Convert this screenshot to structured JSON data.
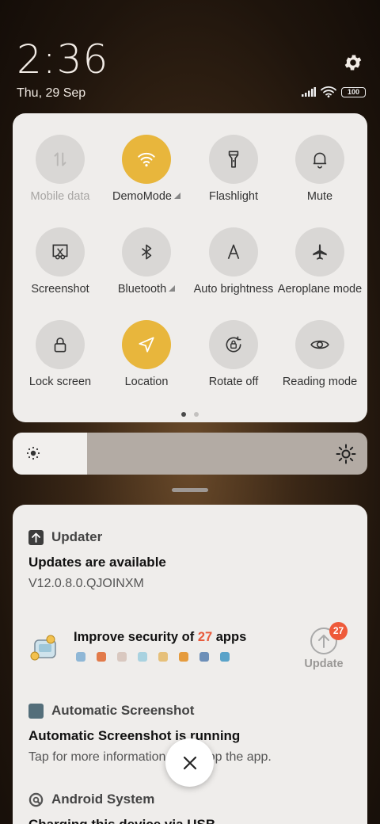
{
  "status": {
    "time": "2:36",
    "date": "Thu, 29 Sep",
    "battery": "100"
  },
  "quick_settings": {
    "tiles": [
      {
        "label": "Mobile data",
        "icon": "mobile-data-icon",
        "active": false,
        "dim": true
      },
      {
        "label": "DemoMode",
        "icon": "wifi-icon",
        "active": true,
        "has_arrow": true
      },
      {
        "label": "Flashlight",
        "icon": "flashlight-icon",
        "active": false
      },
      {
        "label": "Mute",
        "icon": "bell-icon",
        "active": false
      },
      {
        "label": "Screenshot",
        "icon": "screenshot-icon",
        "active": false
      },
      {
        "label": "Bluetooth",
        "icon": "bluetooth-icon",
        "active": false,
        "has_arrow": true
      },
      {
        "label": "Auto brightness",
        "icon": "auto-brightness-icon",
        "active": false
      },
      {
        "label": "Aeroplane mode",
        "icon": "aeroplane-icon",
        "active": false
      },
      {
        "label": "Lock screen",
        "icon": "lock-icon",
        "active": false
      },
      {
        "label": "Location",
        "icon": "location-icon",
        "active": true
      },
      {
        "label": "Rotate off",
        "icon": "rotate-lock-icon",
        "active": false
      },
      {
        "label": "Reading mode",
        "icon": "eye-icon",
        "active": false
      }
    ],
    "page_count": 2,
    "current_page": 1
  },
  "brightness": {
    "level": 0.21
  },
  "notifications": {
    "updater": {
      "app": "Updater",
      "title": "Updates are available",
      "body": "V12.0.8.0.QJOINXM"
    },
    "security": {
      "title_prefix": "Improve security of ",
      "count": "27",
      "title_suffix": " apps",
      "badge": "27",
      "button": "Update"
    },
    "screenshot": {
      "app": "Automatic Screenshot",
      "title": "Automatic Screenshot is running",
      "body": "Tap for more information or to stop the app."
    },
    "android": {
      "app": "Android System",
      "title": "Charging this device via USB"
    }
  },
  "colors": {
    "accent": "#e8b63c",
    "badge": "#ee5a3a",
    "panel": "#efedeb"
  }
}
